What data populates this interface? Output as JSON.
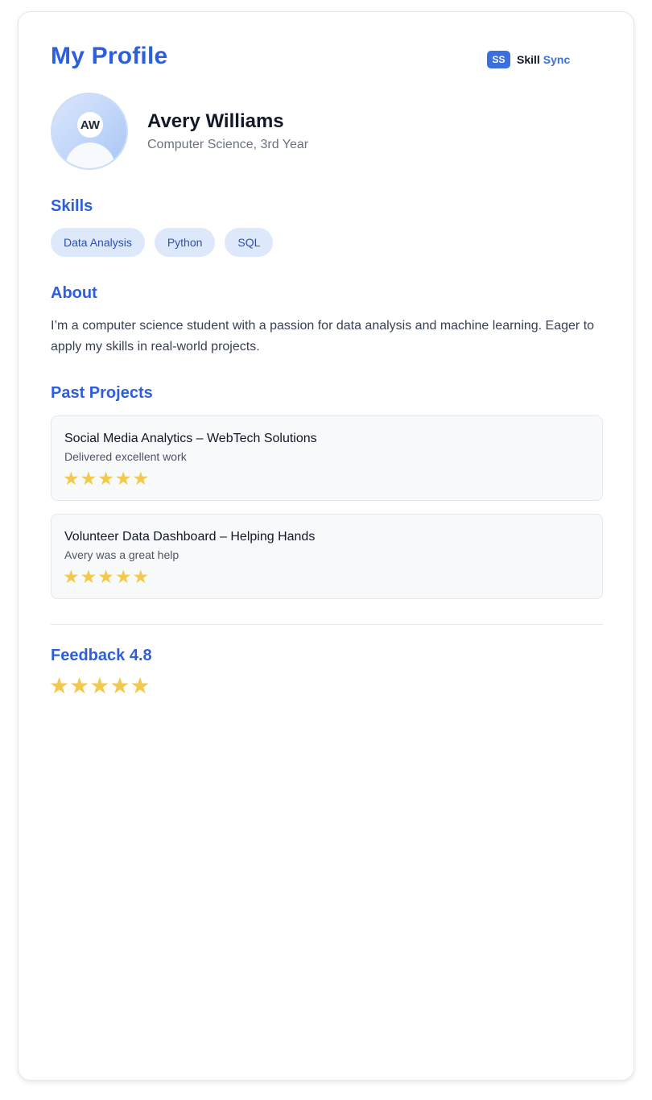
{
  "header": {
    "title": "My Profile",
    "brand": {
      "badge": "SS",
      "name": "Skill",
      "accent": "Sync",
      "accent_color": "#3b6fe0"
    }
  },
  "profile": {
    "initials": "AW",
    "name": "Avery Williams",
    "subtitle": "Computer Science, 3rd Year"
  },
  "skills": {
    "heading": "Skills",
    "items": [
      "Data Analysis",
      "Python",
      "SQL"
    ]
  },
  "about": {
    "heading": "About",
    "text": "I’m a computer science student with a passion for data analysis and machine learning. Eager to apply my skills in real-world projects."
  },
  "projects": {
    "heading": "Past Projects",
    "items": [
      {
        "title": "Social Media Analytics – WebTech Solutions",
        "feedback": "Delivered excellent work",
        "rating": 5
      },
      {
        "title": "Volunteer Data Dashboard – Helping Hands",
        "feedback": "Avery was a great help",
        "rating": 5
      }
    ]
  },
  "feedback": {
    "heading": "Feedback 4.8",
    "stars_shown": 5
  },
  "colors": {
    "accent": "#2d5fdc",
    "star": "#f2c94c",
    "chip_bg": "#dde8fb"
  },
  "icons": {
    "star": "star-icon",
    "avatar": "user-silhouette-icon"
  }
}
